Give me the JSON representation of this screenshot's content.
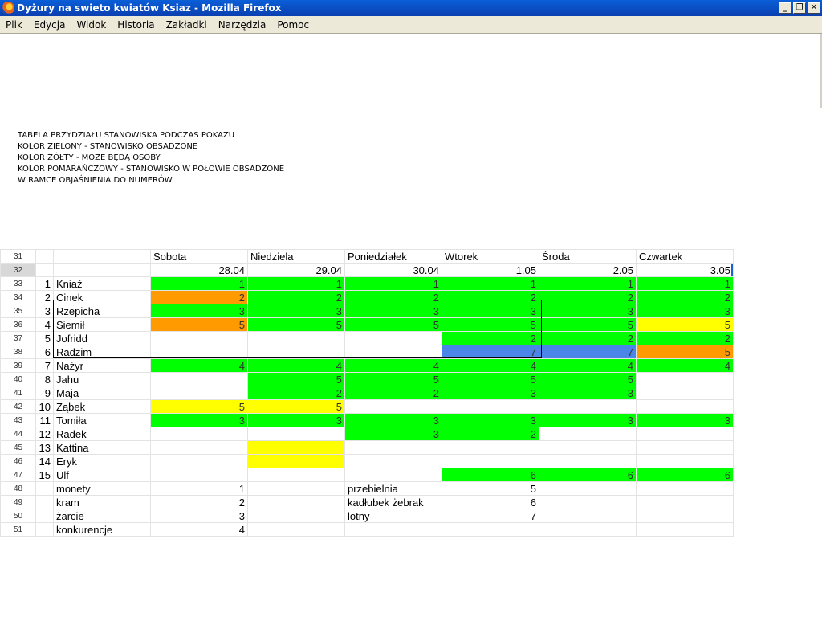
{
  "window": {
    "title": "Dyżury na swieto kwiatów Ksiaz - Mozilla Firefox",
    "minimize": "_",
    "restore": "❐",
    "close": "✕"
  },
  "menu": [
    "Plik",
    "Edycja",
    "Widok",
    "Historia",
    "Zakładki",
    "Narzędzia",
    "Pomoc"
  ],
  "notes": [
    "TABELA PRZYDZIAŁU STANOWISKA PODCZAS POKAZU",
    "KOLOR ZIELONY - STANOWISKO OBSADZONE",
    "KOLOR ŻÓŁTY - MOŻE BĘDĄ OSOBY",
    "KOLOR POMARAŃCZOWY - STANOWISKO W POŁOWIE OBSADZONE",
    "W RAMCE OBJAŚNIENIA DO NUMERÓW"
  ],
  "colors": {
    "green": "#00ff00",
    "orange": "#ff9a00",
    "yellow": "#ffff00",
    "blue": "#4a86e8"
  },
  "sheet": {
    "day_row": {
      "row": "31",
      "days": [
        "Sobota",
        "Niedziela",
        "Poniedziałek",
        "Wtorek",
        "Środa",
        "Czwartek"
      ]
    },
    "date_row": {
      "row": "32",
      "dates": [
        "28.04",
        "29.04",
        "30.04",
        "1.05",
        "2.05",
        "3.05"
      ]
    },
    "people": [
      {
        "row": "33",
        "idx": "1",
        "name": "Kniaź",
        "cells": [
          [
            "1",
            "g"
          ],
          [
            "1",
            "g"
          ],
          [
            "1",
            "g"
          ],
          [
            "1",
            "g"
          ],
          [
            "1",
            "g"
          ],
          [
            "1",
            "g"
          ]
        ]
      },
      {
        "row": "34",
        "idx": "2",
        "name": "Cinek",
        "cells": [
          [
            "2",
            "o"
          ],
          [
            "2",
            "g"
          ],
          [
            "2",
            "g"
          ],
          [
            "2",
            "g"
          ],
          [
            "2",
            "g"
          ],
          [
            "2",
            "g"
          ]
        ]
      },
      {
        "row": "35",
        "idx": "3",
        "name": "Rzepicha",
        "cells": [
          [
            "3",
            "g"
          ],
          [
            "3",
            "g"
          ],
          [
            "3",
            "g"
          ],
          [
            "3",
            "g"
          ],
          [
            "3",
            "g"
          ],
          [
            "3",
            "g"
          ]
        ]
      },
      {
        "row": "36",
        "idx": "4",
        "name": "Siemił",
        "cells": [
          [
            "5",
            "o"
          ],
          [
            "5",
            "g"
          ],
          [
            "5",
            "g"
          ],
          [
            "5",
            "g"
          ],
          [
            "5",
            "g"
          ],
          [
            "5",
            "y"
          ]
        ]
      },
      {
        "row": "37",
        "idx": "5",
        "name": "Jofridd",
        "cells": [
          [
            "",
            ""
          ],
          [
            "",
            ""
          ],
          [
            "",
            ""
          ],
          [
            "2",
            "g"
          ],
          [
            "2",
            "g"
          ],
          [
            "2",
            "g"
          ]
        ]
      },
      {
        "row": "38",
        "idx": "6",
        "name": "Radzim",
        "cells": [
          [
            "",
            ""
          ],
          [
            "",
            ""
          ],
          [
            "",
            ""
          ],
          [
            "7",
            "b"
          ],
          [
            "7",
            "b"
          ],
          [
            "5",
            "o"
          ]
        ]
      },
      {
        "row": "39",
        "idx": "7",
        "name": "Nażyr",
        "cells": [
          [
            "4",
            "g"
          ],
          [
            "4",
            "g"
          ],
          [
            "4",
            "g"
          ],
          [
            "4",
            "g"
          ],
          [
            "4",
            "g"
          ],
          [
            "4",
            "g"
          ]
        ]
      },
      {
        "row": "40",
        "idx": "8",
        "name": "Jahu",
        "cells": [
          [
            "",
            ""
          ],
          [
            "5",
            "g"
          ],
          [
            "5",
            "g"
          ],
          [
            "5",
            "g"
          ],
          [
            "5",
            "g"
          ],
          [
            "",
            ""
          ]
        ]
      },
      {
        "row": "41",
        "idx": "9",
        "name": "Maja",
        "cells": [
          [
            "",
            ""
          ],
          [
            "2",
            "g"
          ],
          [
            "2",
            "g"
          ],
          [
            "3",
            "g"
          ],
          [
            "3",
            "g"
          ],
          [
            "",
            ""
          ]
        ]
      },
      {
        "row": "42",
        "idx": "10",
        "name": "Ząbek",
        "cells": [
          [
            "5",
            "y"
          ],
          [
            "5",
            "y"
          ],
          [
            "",
            ""
          ],
          [
            "",
            ""
          ],
          [
            "",
            ""
          ],
          [
            "",
            ""
          ]
        ]
      },
      {
        "row": "43",
        "idx": "11",
        "name": "Tomiła",
        "cells": [
          [
            "3",
            "g"
          ],
          [
            "3",
            "g"
          ],
          [
            "3",
            "g"
          ],
          [
            "3",
            "g"
          ],
          [
            "3",
            "g"
          ],
          [
            "3",
            "g"
          ]
        ]
      },
      {
        "row": "44",
        "idx": "12",
        "name": "Radek",
        "cells": [
          [
            "",
            ""
          ],
          [
            "",
            ""
          ],
          [
            "3",
            "g"
          ],
          [
            "2",
            "g"
          ],
          [
            "",
            ""
          ],
          [
            "",
            ""
          ]
        ]
      },
      {
        "row": "45",
        "idx": "13",
        "name": "Kattina",
        "cells": [
          [
            "",
            ""
          ],
          [
            "",
            "y"
          ],
          [
            "",
            ""
          ],
          [
            "",
            ""
          ],
          [
            "",
            ""
          ],
          [
            "",
            ""
          ]
        ]
      },
      {
        "row": "46",
        "idx": "14",
        "name": "Eryk",
        "cells": [
          [
            "",
            ""
          ],
          [
            "",
            "y"
          ],
          [
            "",
            ""
          ],
          [
            "",
            ""
          ],
          [
            "",
            ""
          ],
          [
            "",
            ""
          ]
        ]
      },
      {
        "row": "47",
        "idx": "15",
        "name": "Ulf",
        "cells": [
          [
            "",
            ""
          ],
          [
            "",
            ""
          ],
          [
            "",
            ""
          ],
          [
            "6",
            "g"
          ],
          [
            "6",
            "g"
          ],
          [
            "6",
            "g"
          ]
        ]
      }
    ],
    "legend": [
      {
        "row": "48",
        "a": "monety",
        "an": "1",
        "b": "przebielnia",
        "bn": "5"
      },
      {
        "row": "49",
        "a": "kram",
        "an": "2",
        "b": "kadłubek żebrak",
        "bn": "6"
      },
      {
        "row": "50",
        "a": "żarcie",
        "an": "3",
        "b": "lotny",
        "bn": "7"
      },
      {
        "row": "51",
        "a": "konkurencje",
        "an": "4",
        "b": "",
        "bn": ""
      }
    ]
  }
}
